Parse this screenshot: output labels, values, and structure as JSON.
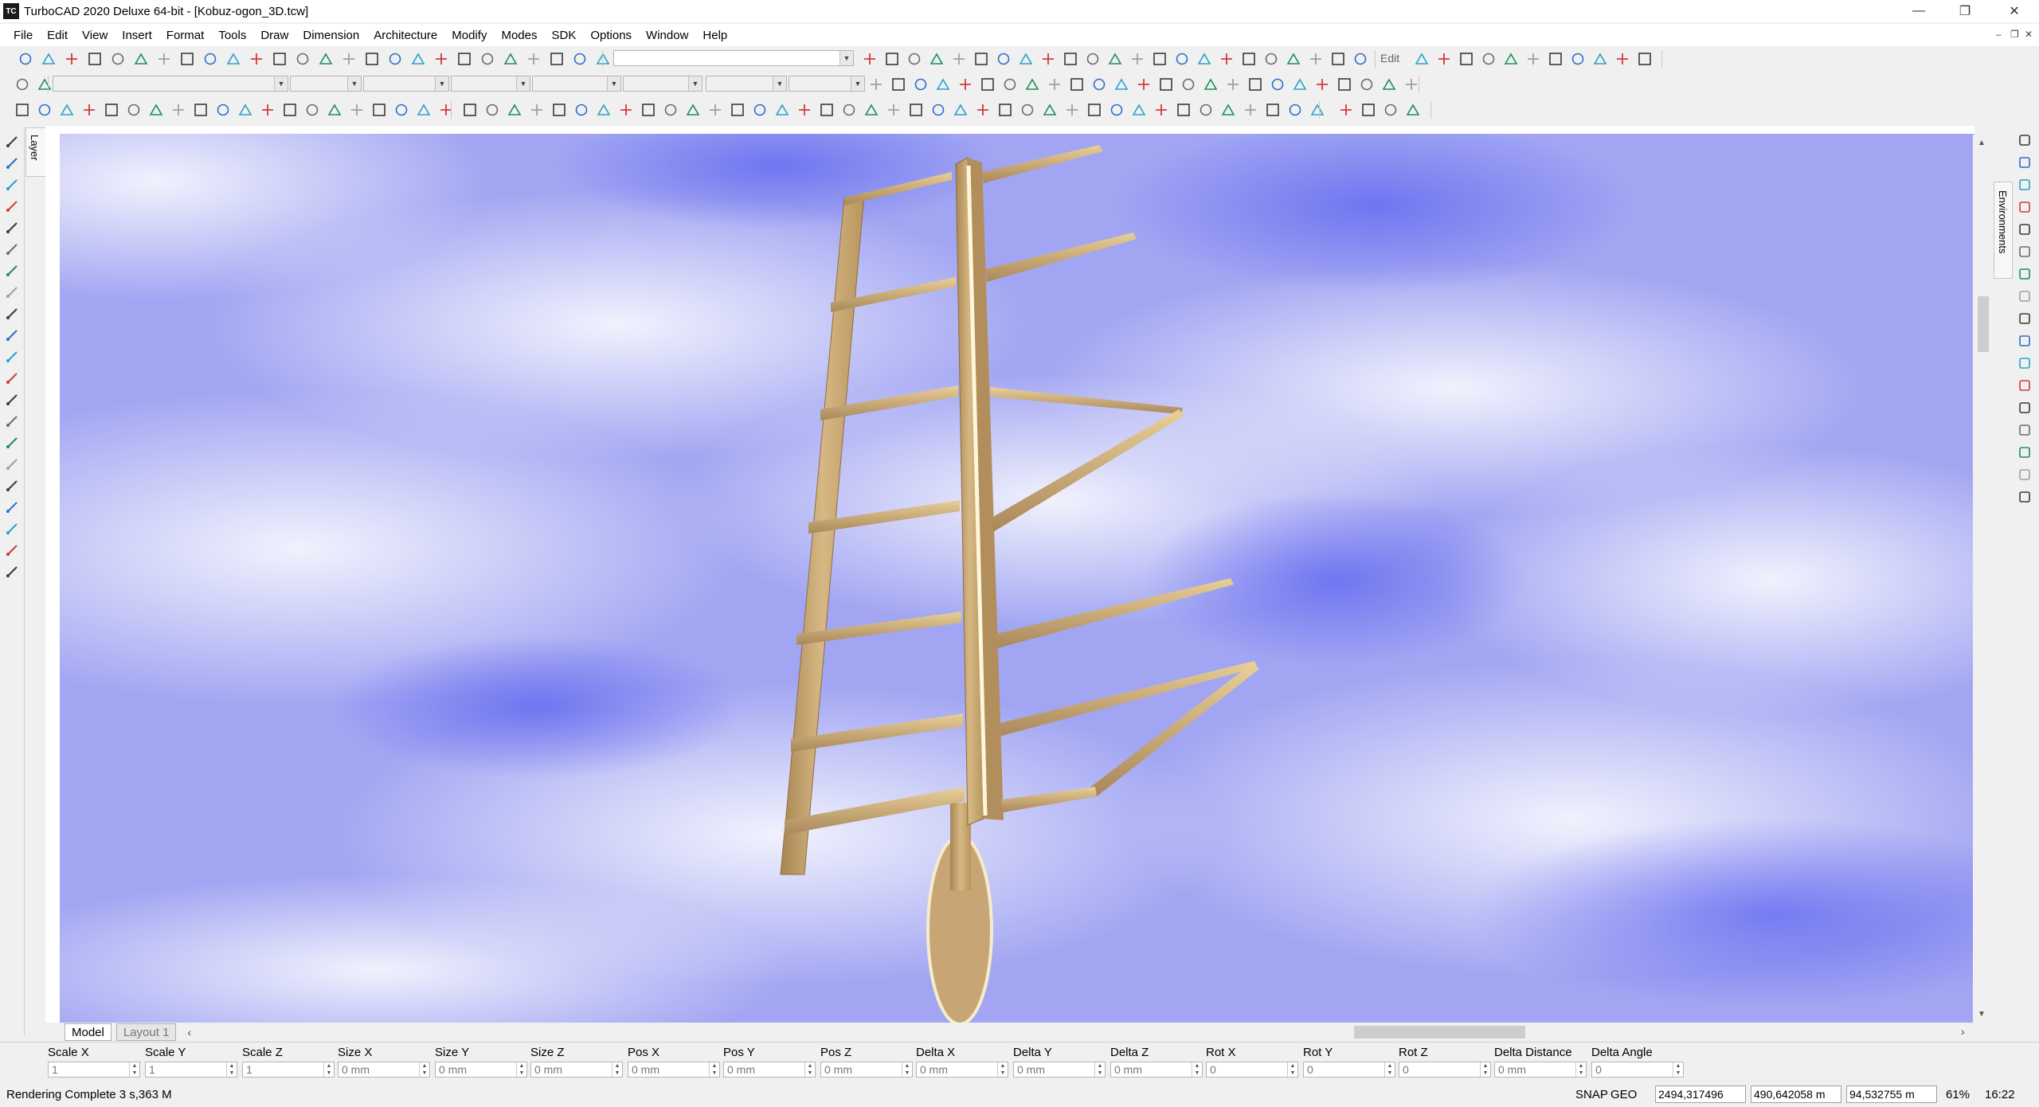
{
  "window": {
    "app_icon": "TC",
    "title": "TurboCAD 2020 Deluxe 64-bit - [Kobuz-ogon_3D.tcw]",
    "minimize_icon": "minimize-icon",
    "restore_icon": "restore-icon",
    "close_icon": "close-icon"
  },
  "menu": [
    "File",
    "Edit",
    "View",
    "Insert",
    "Format",
    "Tools",
    "Draw",
    "Dimension",
    "Architecture",
    "Modify",
    "Modes",
    "SDK",
    "Options",
    "Window",
    "Help"
  ],
  "toolbar": {
    "edit_label": "Edit"
  },
  "side_tabs": {
    "layer": "Layer",
    "environments": "Environments"
  },
  "layout_tabs": {
    "model": "Model",
    "layout1": "Layout 1"
  },
  "inspector": [
    {
      "label": "Scale X",
      "value": "1"
    },
    {
      "label": "Scale Y",
      "value": "1"
    },
    {
      "label": "Scale Z",
      "value": "1"
    },
    {
      "label": "Size X",
      "value": "0 mm"
    },
    {
      "label": "Size Y",
      "value": "0 mm"
    },
    {
      "label": "Size Z",
      "value": "0 mm"
    },
    {
      "label": "Pos X",
      "value": "0 mm"
    },
    {
      "label": "Pos Y",
      "value": "0 mm"
    },
    {
      "label": "Pos Z",
      "value": "0 mm"
    },
    {
      "label": "Delta X",
      "value": "0 mm"
    },
    {
      "label": "Delta Y",
      "value": "0 mm"
    },
    {
      "label": "Delta Z",
      "value": "0 mm"
    },
    {
      "label": "Rot X",
      "value": "0"
    },
    {
      "label": "Rot Y",
      "value": "0"
    },
    {
      "label": "Rot Z",
      "value": "0"
    },
    {
      "label": "Delta Distance",
      "value": "0 mm"
    },
    {
      "label": "Delta Angle",
      "value": "0"
    }
  ],
  "status": {
    "message": "Rendering Complete 3 s,363 M",
    "snap": "SNAP",
    "geo": "GEO",
    "coord_x": "2494,317496",
    "coord_y": "490,642058 m",
    "coord_z": "94,532755 m",
    "zoom": "61%",
    "time": "16:22"
  },
  "colors": {
    "wood": "#d7b884",
    "wood_dark": "#a88654",
    "sky": "#9aa0f2"
  }
}
